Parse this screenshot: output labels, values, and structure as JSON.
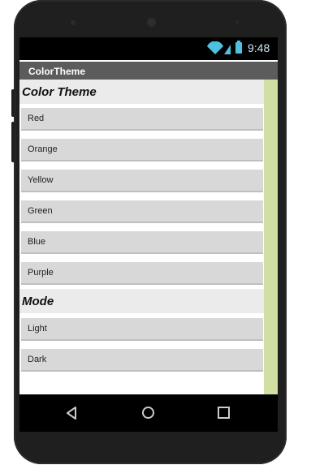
{
  "status_bar": {
    "time": "9:48",
    "icons": [
      "wifi-icon",
      "signal-icon",
      "battery-icon"
    ]
  },
  "app": {
    "title": "ColorTheme"
  },
  "sections": [
    {
      "header": "Color Theme",
      "items": [
        "Red",
        "Orange",
        "Yellow",
        "Green",
        "Blue",
        "Purple"
      ]
    },
    {
      "header": "Mode",
      "items": [
        "Light",
        "Dark"
      ]
    }
  ],
  "nav_bar": {
    "icons": [
      "back-icon",
      "home-icon",
      "recent-apps-icon"
    ]
  },
  "colors": {
    "title_bar": "#5c5c5c",
    "list_item": "#d8d8d8",
    "section_header": "#ebebeb",
    "right_strip": "#d1dfa2",
    "battery": "#4ec1df"
  }
}
